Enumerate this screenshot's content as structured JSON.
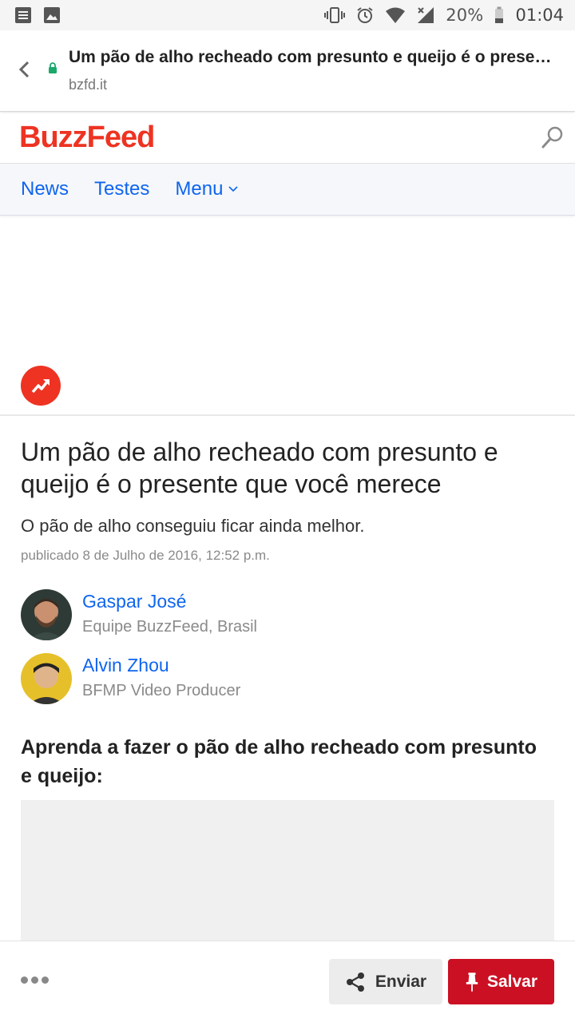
{
  "status_bar": {
    "battery": "20%",
    "time": "01:04",
    "icons": [
      "notes-icon",
      "image-icon",
      "vibrate-icon",
      "alarm-icon",
      "wifi-icon",
      "cell-signal-icon",
      "battery-icon"
    ]
  },
  "tab": {
    "title": "Um pão de alho recheado com presunto e queijo é o present…",
    "url": "bzfd.it"
  },
  "site": {
    "logo": "BuzzFeed",
    "brand_color": "#ee3322",
    "link_color": "#0f65ef"
  },
  "nav": {
    "items": [
      {
        "label": "News"
      },
      {
        "label": "Testes"
      },
      {
        "label": "Menu"
      }
    ]
  },
  "article": {
    "headline": "Um pão de alho recheado com presunto e queijo é o presente que você merece",
    "dek": "O pão de alho conseguiu ficar ainda melhor.",
    "published": "publicado 8 de Julho de 2016, 12:52 p.m.",
    "authors": [
      {
        "name": "Gaspar José",
        "role": "Equipe BuzzFeed, Brasil"
      },
      {
        "name": "Alvin Zhou",
        "role": "BFMP Video Producer"
      }
    ],
    "subhead": "Aprenda a fazer o pão de alho recheado com presunto e queijo:"
  },
  "actions": {
    "share_label": "Enviar",
    "save_label": "Salvar",
    "save_color": "#cb1023"
  }
}
